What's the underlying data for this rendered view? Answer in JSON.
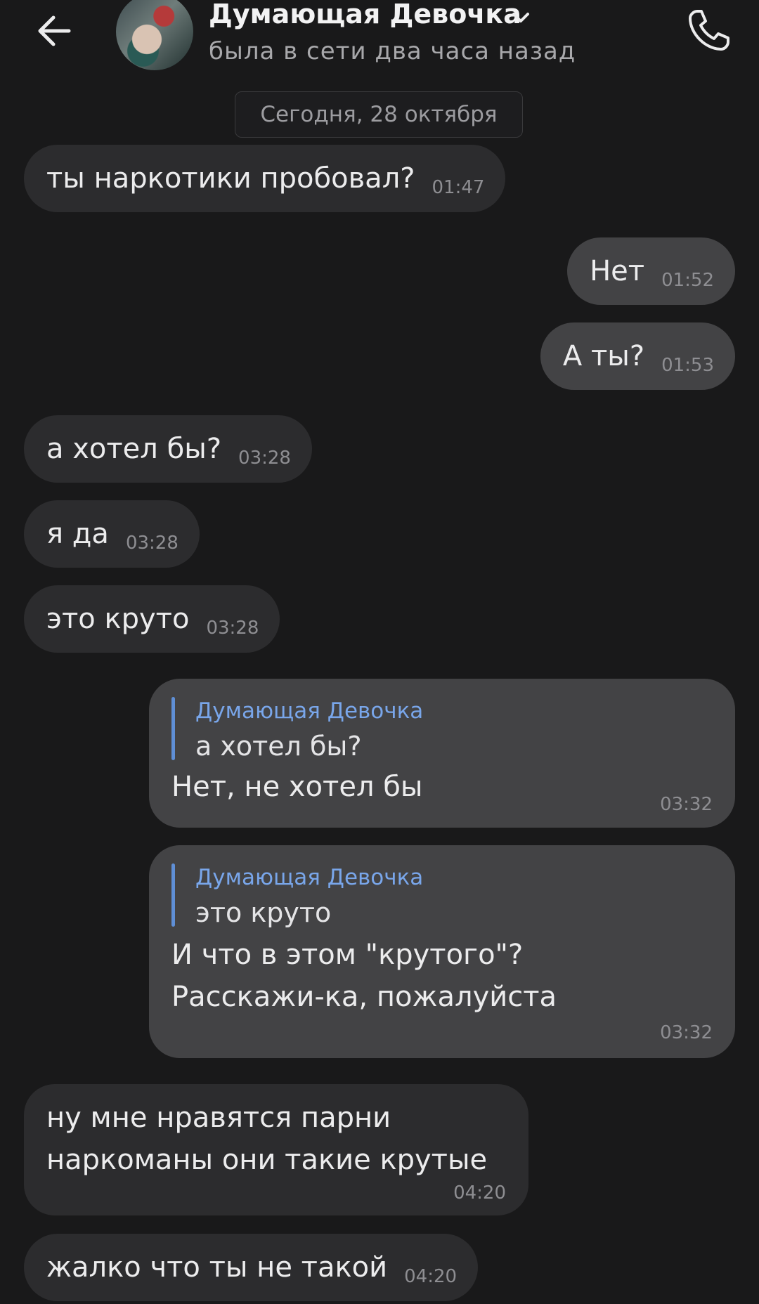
{
  "header": {
    "contact_name": "Думающая Девочка",
    "status": "была в сети два часа назад"
  },
  "date_separator": "Сегодня, 28 октября",
  "messages": [
    {
      "direction": "in",
      "text": "ты наркотики пробовал?",
      "time": "01:47"
    },
    {
      "direction": "out",
      "text": "Нет",
      "time": "01:52"
    },
    {
      "direction": "out",
      "text": "А ты?",
      "time": "01:53"
    },
    {
      "direction": "in",
      "text": "а хотел бы?",
      "time": "03:28"
    },
    {
      "direction": "in",
      "text": "я да",
      "time": "03:28"
    },
    {
      "direction": "in",
      "text": "это круто",
      "time": "03:28"
    },
    {
      "direction": "out",
      "reply_to": {
        "author": "Думающая Девочка",
        "text": "а хотел бы?"
      },
      "lines": [
        "Нет, не хотел бы"
      ],
      "time": "03:32"
    },
    {
      "direction": "out",
      "reply_to": {
        "author": "Думающая Девочка",
        "text": "это круто"
      },
      "lines": [
        "И что в этом \"крутого\"?",
        "Расскажи-ка, пожалуйста"
      ],
      "time": "03:32"
    },
    {
      "direction": "in",
      "lines": [
        "ну мне нравятся парни",
        "наркоманы они такие крутые"
      ],
      "time": "04:20"
    },
    {
      "direction": "in",
      "text": "жалко что ты не такой",
      "time": "04:20"
    }
  ],
  "icons": {
    "back": "arrow-left-icon",
    "expand": "chevron-down-icon",
    "call": "phone-icon"
  },
  "colors": {
    "background": "#19191a",
    "incoming_bubble": "#2c2c2e",
    "outgoing_bubble": "#434345",
    "reply_accent": "#79a6ea"
  }
}
